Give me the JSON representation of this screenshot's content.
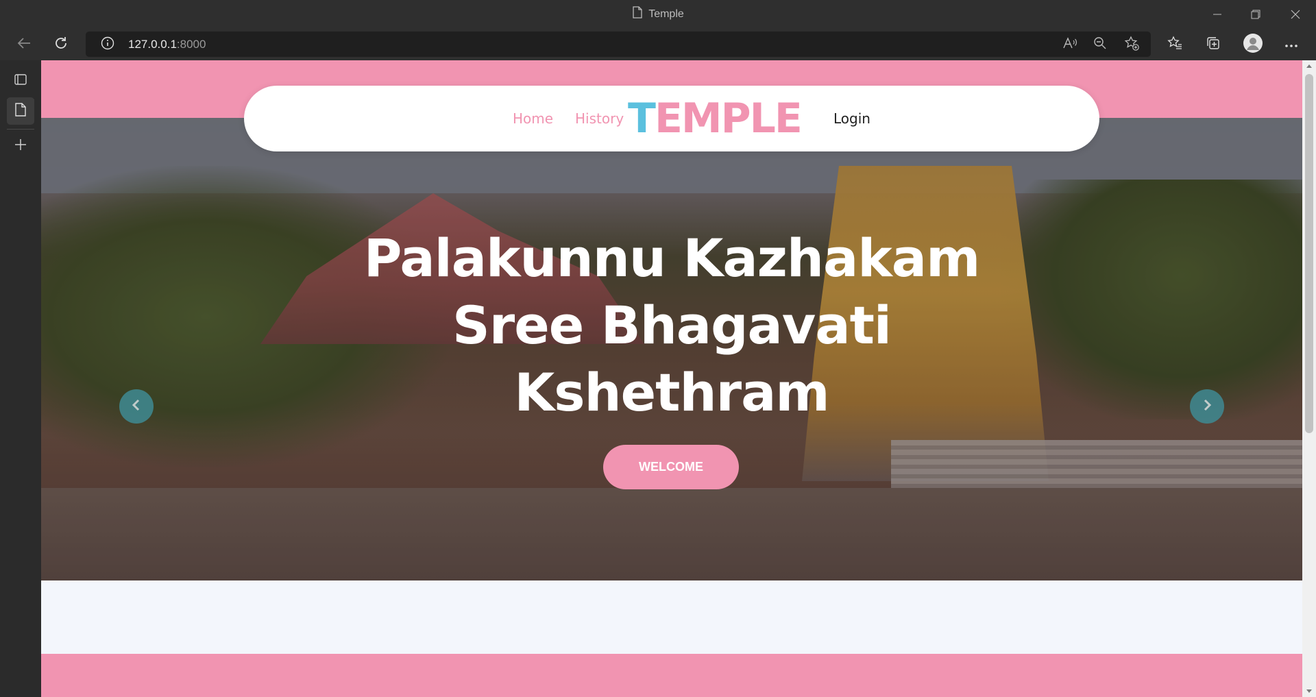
{
  "browser": {
    "tab_title": "Temple",
    "url_host": "127.0.0.1",
    "url_port": ":8000"
  },
  "site": {
    "nav": {
      "home": "Home",
      "history": "History",
      "logo_first": "T",
      "logo_rest": "EMPLE",
      "login": "Login"
    },
    "hero": {
      "title_line1": "Palakunnu Kazhakam",
      "title_line2": "Sree Bhagavati",
      "title_line3": "Kshethram",
      "button": "WELCOME"
    }
  },
  "colors": {
    "brand_pink": "#f194b1",
    "logo_blue": "#5bc0de",
    "page_bg": "#f3f6fc"
  },
  "icons": [
    "page-icon",
    "back-icon",
    "refresh-icon",
    "info-icon",
    "read-aloud-icon",
    "zoom-out-icon",
    "add-favorite-icon",
    "favorites-icon",
    "collections-icon",
    "profile-icon",
    "more-icon",
    "tab-actions-icon",
    "vertical-tab-icon",
    "new-tab-icon",
    "chevron-left-icon",
    "chevron-right-icon"
  ]
}
